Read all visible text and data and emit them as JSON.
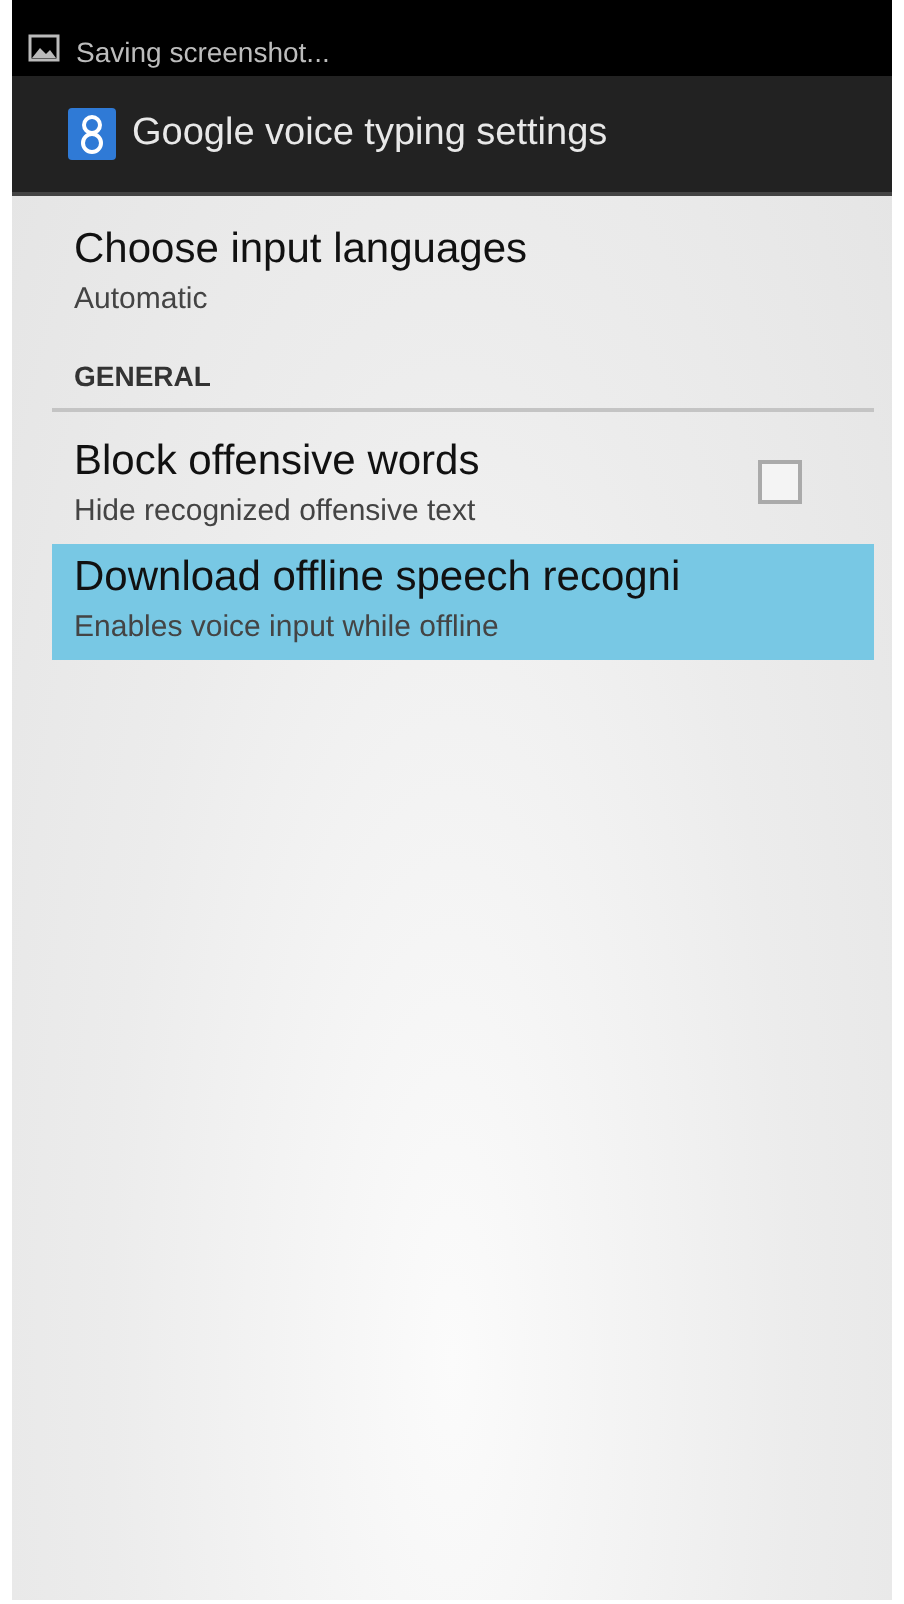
{
  "status_bar": {
    "notification": "Saving screenshot..."
  },
  "action_bar": {
    "title": "Google voice typing settings"
  },
  "items": [
    {
      "kind": "preference",
      "title": "Choose input languages",
      "summary": "Automatic",
      "selected": false
    },
    {
      "kind": "category",
      "title": "GENERAL"
    },
    {
      "kind": "checkbox",
      "title": "Block offensive words",
      "summary": "Hide recognized offensive text",
      "checked": false,
      "selected": false
    },
    {
      "kind": "preference",
      "title": "Download offline speech recogni",
      "summary": "Enables voice input while offline",
      "selected": true
    }
  ]
}
